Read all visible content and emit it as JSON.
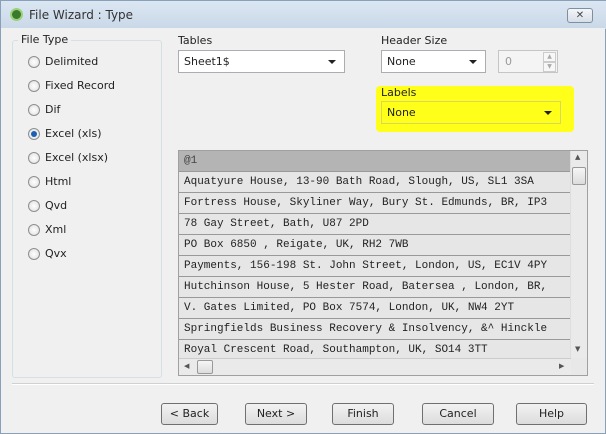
{
  "window": {
    "title": "File Wizard : Type"
  },
  "file_type": {
    "label": "File Type",
    "options": [
      "Delimited",
      "Fixed Record",
      "Dif",
      "Excel (xls)",
      "Excel (xlsx)",
      "Html",
      "Qvd",
      "Xml",
      "Qvx"
    ],
    "selected": "Excel (xls)"
  },
  "tables": {
    "label": "Tables",
    "value": "Sheet1$"
  },
  "header_size": {
    "label": "Header Size",
    "value": "None",
    "spin_value": "0"
  },
  "labels": {
    "label": "Labels",
    "value": "None",
    "highlight_color": "#ffff1a"
  },
  "preview": {
    "header": "@1",
    "rows": [
      "Aquatyure House, 13-90 Bath Road, Slough, US, SL1 3SA",
      "Fortress House, Skyliner Way, Bury St. Edmunds, BR, IP3",
      "78 Gay Street, Bath,  U87 2PD",
      "PO Box 6850 , Reigate, UK, RH2 7WB",
      "Payments, 156-198 St. John Street, London, US, EC1V 4PY",
      "Hutchinson House, 5 Hester Road, Batersea , London, BR,",
      "V. Gates Limited, PO Box 7574, London, UK, NW4 2YT",
      "Springfields Business Recovery & Insolvency, &^ Hinckle",
      "Royal Crescent Road, Southampton, UK, SO14 3TT"
    ]
  },
  "buttons": {
    "back": "< Back",
    "next": "Next >",
    "finish": "Finish",
    "cancel": "Cancel",
    "help": "Help"
  }
}
